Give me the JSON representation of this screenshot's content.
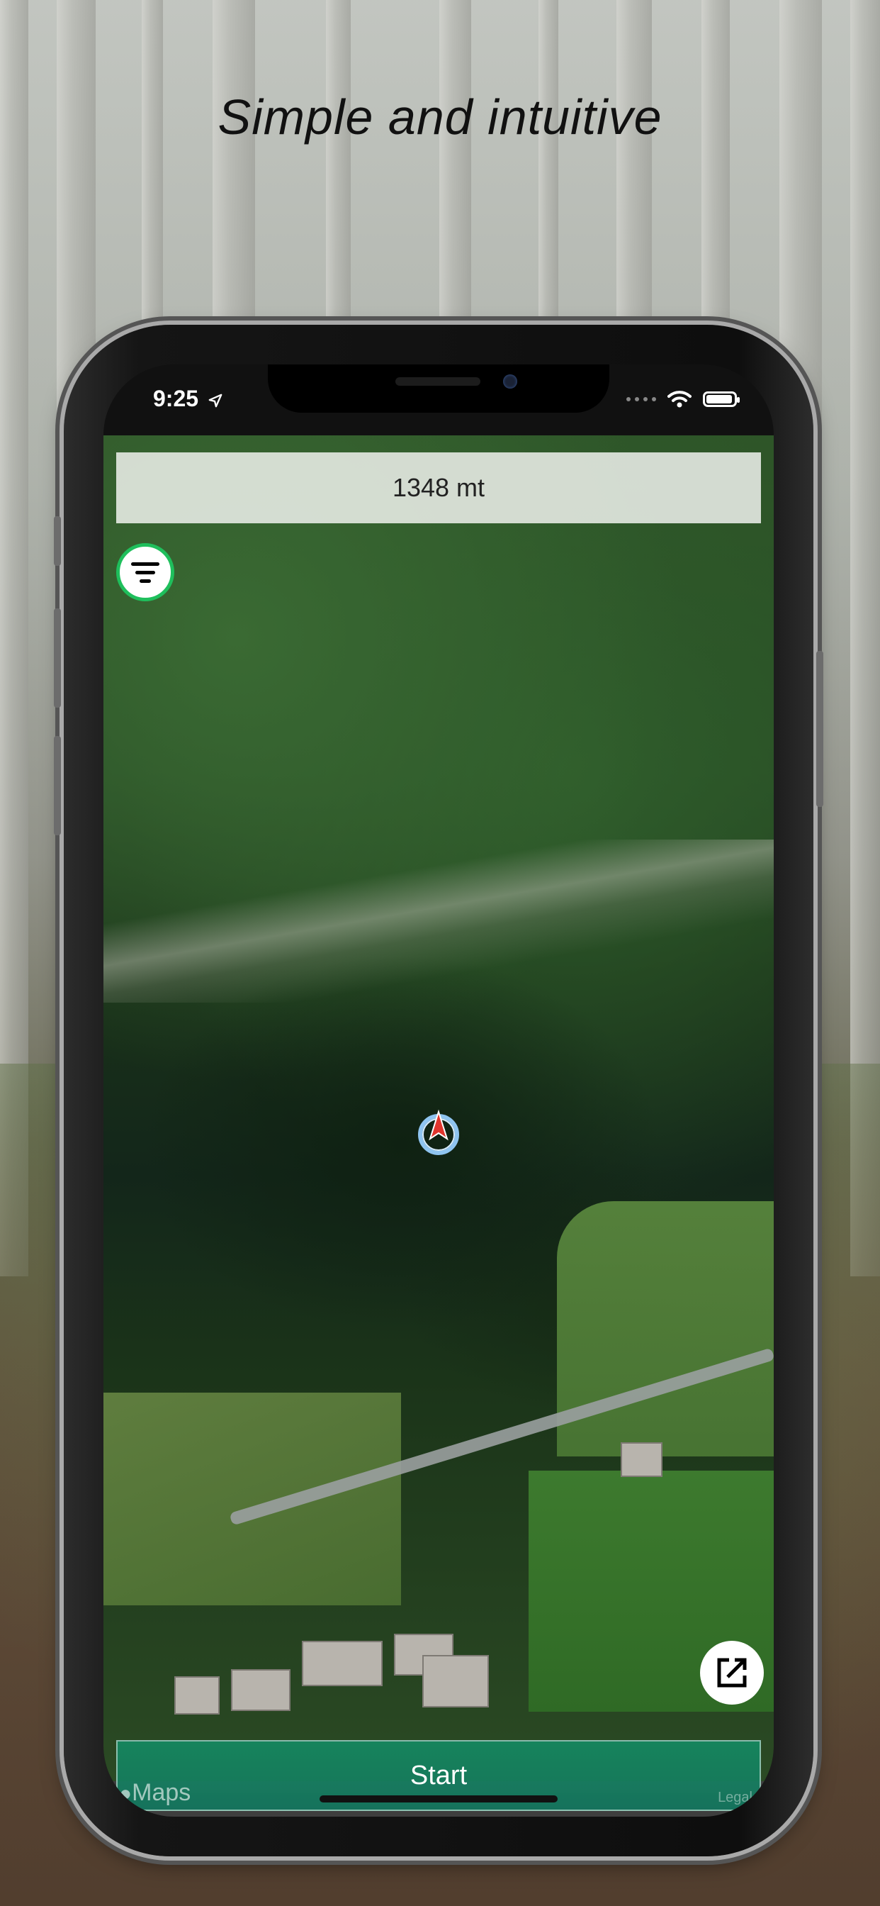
{
  "headline": "Simple and intuitive",
  "status_bar": {
    "time": "9:25",
    "icons": [
      "location-arrow-icon",
      "signal-dots-icon",
      "wifi-icon",
      "battery-icon"
    ]
  },
  "map": {
    "altitude_label": "1348 mt",
    "attribution": "Maps",
    "legal": "Legal",
    "start_label": "Start",
    "accent_green": "#1fbf5c"
  }
}
